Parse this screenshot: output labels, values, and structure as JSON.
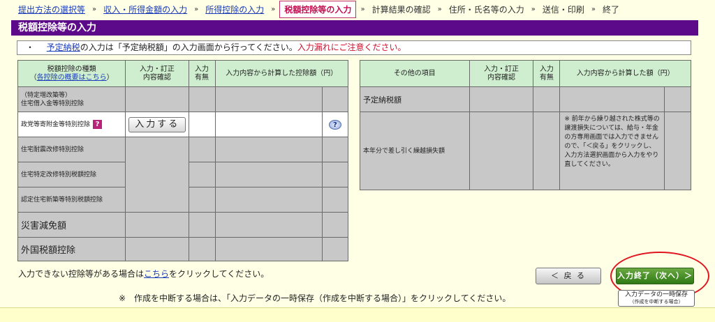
{
  "breadcrumb": {
    "items": [
      {
        "label": "提出方法の選択等",
        "kind": "link"
      },
      {
        "label": "収入・所得金額の入力",
        "kind": "link"
      },
      {
        "label": "所得控除の入力",
        "kind": "link"
      },
      {
        "label": "税額控除等の入力",
        "kind": "current"
      },
      {
        "label": "計算結果の確認",
        "kind": "plain"
      },
      {
        "label": "住所・氏名等の入力",
        "kind": "plain"
      },
      {
        "label": "送信・印刷",
        "kind": "plain"
      },
      {
        "label": "終了",
        "kind": "plain"
      }
    ],
    "separator": "»"
  },
  "page_title": "税額控除等の入力",
  "notice": {
    "bullet": "・",
    "link": "予定納税",
    "text": "の入力は「予定納税額」の入力画面から行ってください。",
    "warning": "入力漏れにご注意ください。"
  },
  "left_table": {
    "headers": {
      "type_line1": "税額控除の種類",
      "type_link": "各控除の概要はこちら",
      "type_paren_open": "（",
      "type_paren_close": "）",
      "confirm": "入力・訂正\n内容確認",
      "has_input": "入力\n有無",
      "amount": "入力内容から計算した控除額（円）"
    },
    "rows": [
      {
        "label_line1": "（特定増改築等）",
        "label_line2": "住宅借入金等特別控除"
      },
      {
        "label": "政党等寄附金等特別控除",
        "button": "入力する"
      },
      {
        "label": "住宅耐震改修特別控除"
      },
      {
        "label": "住宅特定改修特別税額控除"
      },
      {
        "label": "認定住宅新築等特別税額控除"
      },
      {
        "label": "災害減免額"
      },
      {
        "label": "外国税額控除"
      }
    ]
  },
  "right_table": {
    "headers": {
      "item": "その他の項目",
      "confirm": "入力・訂正\n内容確認",
      "has_input": "入力\n有無",
      "amount": "入力内容から計算した額（円）"
    },
    "rows": [
      {
        "label": "予定納税額"
      },
      {
        "label": "本年分で差し引く繰越損失額",
        "note": "※ 前年から繰り越された株式等の譲渡損失については、給与・年金の方専用画面では入力できませんので、「＜戻る」をクリックし、入力方法選択画面から入力をやり直してください。"
      }
    ]
  },
  "bottom_note": {
    "prefix": "入力できない控除等がある場合は",
    "link": "こちら",
    "suffix": "をクリックしてください。"
  },
  "save_note": "※　作成を中断する場合は、「入力データの一時保存（作成を中断する場合）」をクリックしてください。",
  "buttons": {
    "back": "＜ 戻 る",
    "next": "入力終了（次へ）＞",
    "tmp_save_line1": "入力データの一時保存",
    "tmp_save_line2": "（作成を中断する場合）"
  },
  "icons": {
    "question": "question-mark-icon",
    "help": "help-icon"
  },
  "colors": {
    "title_bar": "#5c0a8a",
    "header_bg": "#cfeecf",
    "disabled_cell": "#c8c8c8",
    "next_button": "#2f7a15",
    "highlight_circle": "#e0141e",
    "page_bg": "#ffffe6"
  }
}
